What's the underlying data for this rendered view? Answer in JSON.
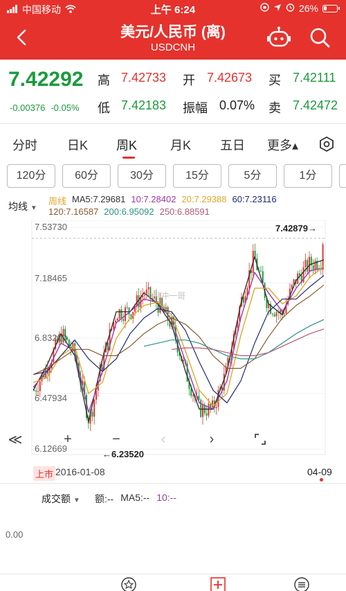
{
  "status": {
    "carrier": "中国移动",
    "time": "上午 6:24",
    "battery": "26%"
  },
  "header": {
    "title": "美元/人民币 (离)",
    "subtitle": "USDCNH"
  },
  "quote": {
    "price": "7.42292",
    "change": "-0.00376",
    "change_pct": "-0.05%",
    "high_label": "高",
    "high": "7.42733",
    "open_label": "开",
    "open": "7.42673",
    "buy_label": "买",
    "buy": "7.42111",
    "low_label": "低",
    "low": "7.42183",
    "amp_label": "振幅",
    "amp": "0.07%",
    "sell_label": "卖",
    "sell": "7.42472"
  },
  "tabs": [
    {
      "label": "分时"
    },
    {
      "label": "日K"
    },
    {
      "label": "周K"
    },
    {
      "label": "月K"
    },
    {
      "label": "五日"
    },
    {
      "label": "更多▴"
    }
  ],
  "periods": [
    {
      "label": "120分"
    },
    {
      "label": "60分"
    },
    {
      "label": "30分"
    },
    {
      "label": "15分"
    },
    {
      "label": "5分"
    },
    {
      "label": "1分"
    }
  ],
  "legend": {
    "selector": "均线",
    "week": "周线",
    "ma5": "MA5:7.29681",
    "ma10": "10:7.28402",
    "ma20": "20:7.29388",
    "ma60": "60:7.23116",
    "ma120": "120:7.16587",
    "ma200": "200:6.95092",
    "ma250": "250:6.88591"
  },
  "colors": {
    "ma5": "#333333",
    "ma10": "#9b3aa8",
    "ma20": "#e1a72b",
    "ma60": "#1f2a7a",
    "ma120": "#8a5a2b",
    "ma200": "#2f8f86",
    "ma250": "#b05a70",
    "up": "#e5322d",
    "down": "#1a9b3c",
    "accent": "#e5322d"
  },
  "chart": {
    "y_labels": [
      "7.53730",
      "7.18465",
      "6.83200",
      "6.47934",
      "6.12669"
    ],
    "last_label": "7.42879→",
    "min_label": "←6.23520",
    "watermark": "@月冲一哥"
  },
  "chart_data": {
    "type": "line",
    "ylim": [
      6.12669,
      7.5373
    ],
    "yticks": [
      "7.53730",
      "7.18465",
      "6.83200",
      "6.47934",
      "6.12669"
    ],
    "x": [
      "2016-01-08",
      "04-09"
    ],
    "series": [
      {
        "name": "MA5:7.29681",
        "values": [
          6.5,
          6.66,
          6.86,
          6.72,
          6.3,
          6.7,
          7.0,
          7.0,
          7.12,
          7.05,
          6.92,
          6.62,
          6.38,
          6.38,
          6.62,
          7.05,
          7.35,
          7.05,
          6.98,
          7.2,
          7.3,
          7.33
        ]
      },
      {
        "name": "10:7.28402",
        "values": [
          6.52,
          6.62,
          6.8,
          6.75,
          6.36,
          6.62,
          6.93,
          7.0,
          7.08,
          7.06,
          6.95,
          6.68,
          6.42,
          6.38,
          6.56,
          6.96,
          7.25,
          7.12,
          7.0,
          7.15,
          7.26,
          7.28
        ]
      },
      {
        "name": "20:7.29388",
        "values": [
          6.55,
          6.58,
          6.72,
          6.78,
          6.48,
          6.55,
          6.83,
          6.96,
          7.04,
          7.06,
          6.98,
          6.75,
          6.5,
          6.4,
          6.48,
          6.85,
          7.15,
          7.15,
          7.05,
          7.1,
          7.22,
          7.29
        ]
      },
      {
        "name": "60:7.23116",
        "values": [
          6.6,
          6.62,
          6.72,
          6.82,
          6.7,
          6.62,
          6.7,
          6.86,
          6.96,
          7.02,
          7.0,
          6.88,
          6.68,
          6.5,
          6.42,
          6.56,
          6.8,
          7.0,
          7.08,
          7.08,
          7.16,
          7.23
        ]
      },
      {
        "name": "120:7.16587",
        "values": [
          6.6,
          6.64,
          6.7,
          6.76,
          6.76,
          6.72,
          6.72,
          6.78,
          6.86,
          6.92,
          6.96,
          6.92,
          6.84,
          6.72,
          6.64,
          6.64,
          6.7,
          6.84,
          6.96,
          7.04,
          7.1,
          7.17
        ]
      },
      {
        "name": "200:6.95092",
        "values": [
          null,
          null,
          null,
          null,
          null,
          null,
          null,
          null,
          6.78,
          6.8,
          6.82,
          6.82,
          6.8,
          6.76,
          6.72,
          6.7,
          6.7,
          6.74,
          6.8,
          6.86,
          6.91,
          6.95
        ]
      },
      {
        "name": "250:6.88591",
        "values": [
          null,
          null,
          null,
          null,
          null,
          null,
          null,
          null,
          null,
          null,
          6.76,
          6.77,
          6.77,
          6.76,
          6.74,
          6.72,
          6.72,
          6.74,
          6.78,
          6.82,
          6.86,
          6.89
        ]
      }
    ],
    "last": 7.42879,
    "min": 6.2352
  },
  "controls": {
    "collapse": "≪",
    "zoom_in": "+",
    "zoom_out": "−",
    "prev": "‹",
    "next": "›"
  },
  "dates": {
    "badge": "上市",
    "start": "2016-01-08",
    "end": "04-09"
  },
  "volume": {
    "selector": "成交额",
    "amount": "额:--",
    "ma5": "MA5:--",
    "ma10": "10:--",
    "axis": "0.00"
  }
}
